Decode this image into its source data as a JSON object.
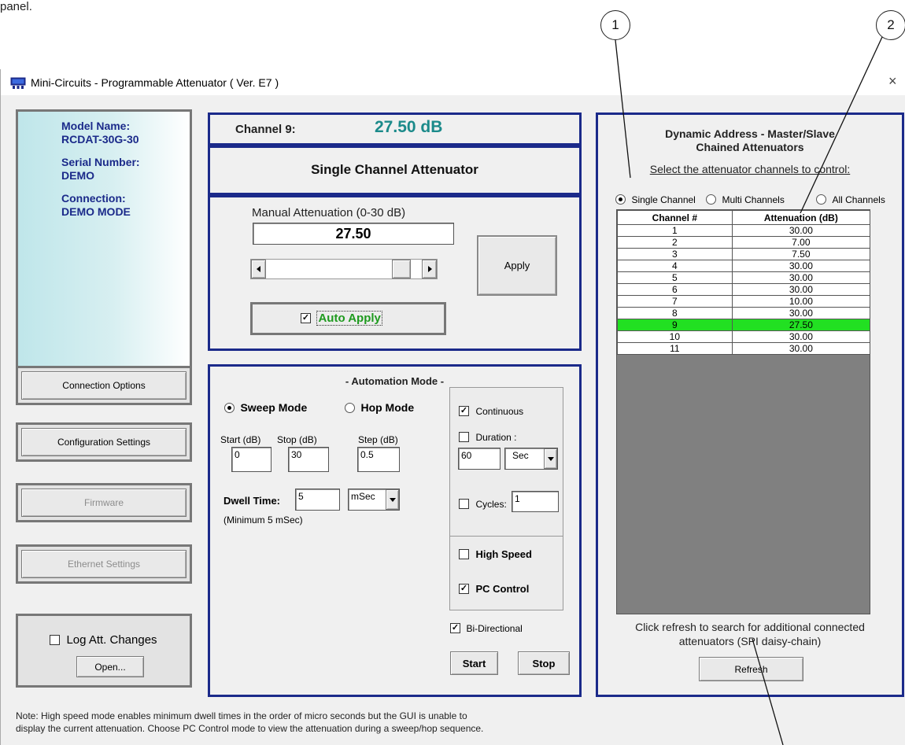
{
  "annotation": {
    "top_text": "panel.",
    "callouts": [
      "1",
      "2"
    ]
  },
  "window": {
    "title": "Mini-Circuits -  Programmable Attenuator  ( Ver. E7 )",
    "close_glyph": "×"
  },
  "device_info": {
    "model_label": "Model Name:",
    "model_value": "RCDAT-30G-30",
    "serial_label": "Serial Number:",
    "serial_value": "DEMO",
    "connection_label": "Connection:",
    "connection_value": "DEMO MODE"
  },
  "side_buttons": {
    "connection_options": "Connection Options",
    "configuration_settings": "Configuration Settings",
    "firmware": "Firmware",
    "ethernet_settings": "Ethernet Settings"
  },
  "log": {
    "checkbox_label": "Log Att. Changes",
    "checked": false,
    "open_button": "Open..."
  },
  "channel": {
    "label": "Channel 9:",
    "value": "27.50 dB",
    "value_color": "#1b8a8a"
  },
  "mode_title": "Single Channel Attenuator",
  "manual": {
    "label": "Manual Attenuation (0-30 dB)",
    "value": "27.50",
    "slider_fraction": 0.9167,
    "apply_button": "Apply",
    "auto_apply_label": "Auto Apply",
    "auto_apply_checked": true,
    "auto_apply_color": "#1e9a1e"
  },
  "automation": {
    "title": "- Automation Mode -",
    "sweep_label": "Sweep Mode",
    "hop_label": "Hop Mode",
    "sweep_selected": true,
    "start_label": "Start (dB)",
    "start_value": "0",
    "stop_label": "Stop (dB)",
    "stop_value": "30",
    "step_label": "Step (dB)",
    "step_value": "0.5",
    "dwell_label": "Dwell Time:",
    "dwell_value": "5",
    "dwell_unit": "mSec",
    "dwell_note": "(Minimum 5 mSec)",
    "continuous_label": "Continuous",
    "continuous_checked": true,
    "duration_label": "Duration :",
    "duration_checked": false,
    "duration_value": "60",
    "duration_unit": "Sec",
    "cycles_label": "Cycles:",
    "cycles_checked": false,
    "cycles_value": "1",
    "high_speed_label": "High Speed",
    "high_speed_checked": false,
    "pc_control_label": "PC Control",
    "pc_control_checked": true,
    "bidirectional_label": "Bi-Directional",
    "bidirectional_checked": true,
    "start_button": "Start",
    "stop_button": "Stop"
  },
  "dynamic": {
    "title_line1": "Dynamic Address - Master/Slave",
    "title_line2": "Chained Attenuators",
    "select_label": "Select the attenuator channels to control:",
    "radio_single": "Single Channel",
    "radio_multi": "Multi Channels",
    "radio_all": "All Channels",
    "selected_mode": "single",
    "table_headers": [
      "Channel #",
      "Attenuation (dB)"
    ],
    "rows": [
      [
        "1",
        "30.00"
      ],
      [
        "2",
        "7.00"
      ],
      [
        "3",
        "7.50"
      ],
      [
        "4",
        "30.00"
      ],
      [
        "5",
        "30.00"
      ],
      [
        "6",
        "30.00"
      ],
      [
        "7",
        "10.00"
      ],
      [
        "8",
        "30.00"
      ],
      [
        "9",
        "27.50"
      ],
      [
        "10",
        "30.00"
      ],
      [
        "11",
        "30.00"
      ]
    ],
    "highlight_row": "9",
    "highlight_color": "#22e022",
    "refresh_text_line1": "Click refresh to search for additional connected",
    "refresh_text_line2": "attenuators (SPI daisy-chain)",
    "refresh_button": "Refresh"
  },
  "note": {
    "line1": "Note: High speed mode enables minimum dwell times in the order of micro seconds  but the GUI is unable to",
    "line2": "display the current attenuation. Choose PC Control mode to view the attenuation during a sweep/hop sequence."
  },
  "icons": {
    "app_icon": "monitor-icon",
    "close": "close-icon",
    "arrow_left": "arrow-left-icon",
    "arrow_right": "arrow-right-icon",
    "dropdown": "chevron-down-icon"
  }
}
